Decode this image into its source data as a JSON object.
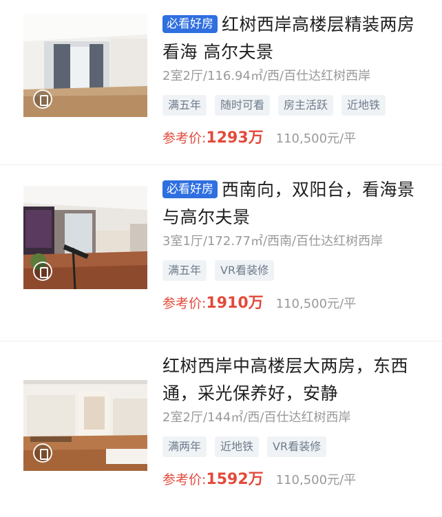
{
  "listings": [
    {
      "badge": "必看好房",
      "title": "红树西岸高楼层精装两房 看海 高尔夫景",
      "meta": "2室2厅/116.94㎡/西/百仕达红树西岸",
      "tags": [
        "满五年",
        "随时可看",
        "房主活跃",
        "近地铁"
      ],
      "price_label": "参考价:",
      "price": "1293万",
      "unit_price": "110,500元/平"
    },
    {
      "badge": "必看好房",
      "title": "西南向，双阳台，看海景与高尔夫景",
      "meta": "3室1厅/172.77㎡/西南/百仕达红树西岸",
      "tags": [
        "满五年",
        "VR看装修"
      ],
      "price_label": "参考价:",
      "price": "1910万",
      "unit_price": "110,500元/平"
    },
    {
      "title": "红树西岸中高楼层大两房，东西通，采光保养好，安静",
      "meta": "2室2厅/144㎡/西/百仕达红树西岸",
      "tags": [
        "满两年",
        "近地铁",
        "VR看装修"
      ],
      "price_label": "参考价:",
      "price": "1592万",
      "unit_price": "110,500元/平"
    }
  ],
  "colors": {
    "badge_bg": "#2f6fe0",
    "price": "#e24a3b",
    "tag_bg": "#f0f3f6",
    "tag_text": "#6d7b8a"
  },
  "icons": {
    "vr": "vr-view-icon"
  }
}
